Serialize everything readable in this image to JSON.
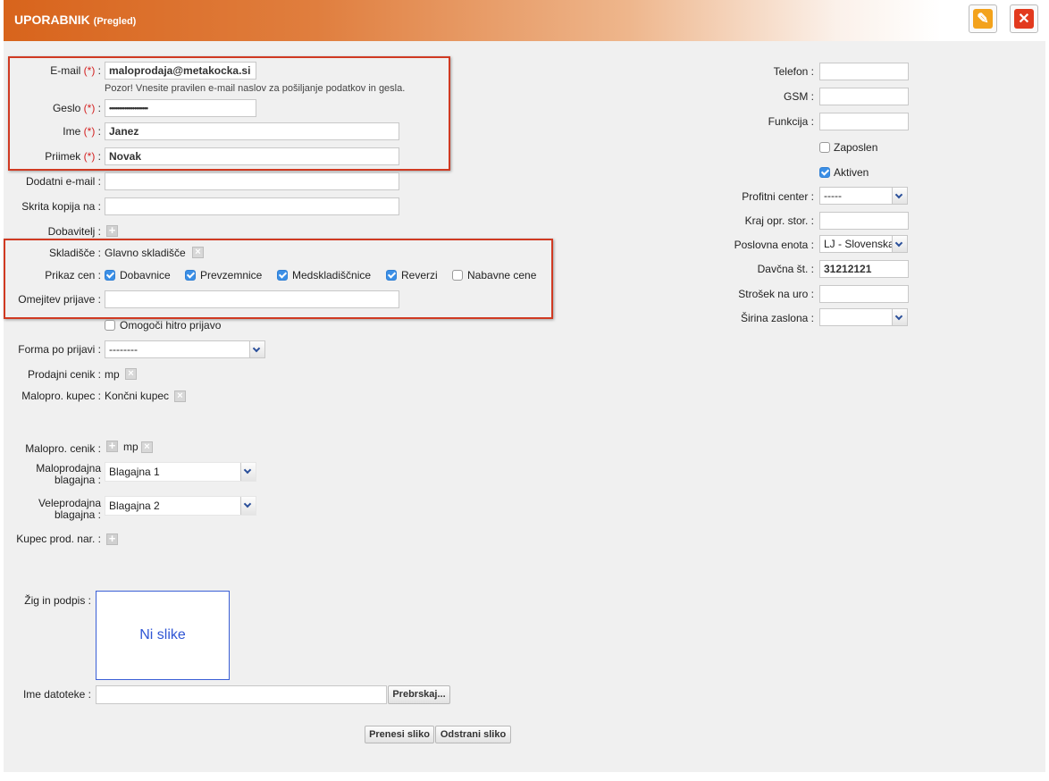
{
  "header": {
    "title": "UPORABNIK",
    "subtitle": "(Pregled)",
    "edit_icon": "pencil-icon",
    "close_icon": "close-icon"
  },
  "left": {
    "email": {
      "label": "E-mail",
      "req": "(*)",
      "value": "maloprodaja@metakocka.si",
      "note": "Pozor! Vnesite pravilen e-mail naslov za pošiljanje podatkov in gesla."
    },
    "geslo": {
      "label": "Geslo",
      "req": "(*)",
      "value": "••••••••••••••••••••"
    },
    "ime": {
      "label": "Ime",
      "req": "(*)",
      "value": "Janez"
    },
    "priimek": {
      "label": "Priimek",
      "req": "(*)",
      "value": "Novak"
    },
    "dodatni_email": {
      "label": "Dodatni e-mail :",
      "value": ""
    },
    "skrita_kopija": {
      "label": "Skrita kopija na :",
      "value": ""
    },
    "dobavitelj": {
      "label": "Dobavitelj :"
    },
    "skladisce": {
      "label": "Skladišče :",
      "value": "Glavno skladišče"
    },
    "prikaz_cen": {
      "label": "Prikaz cen :",
      "options": [
        {
          "label": "Dobavnice",
          "checked": true
        },
        {
          "label": "Prevzemnice",
          "checked": true
        },
        {
          "label": "Medskladiščnice",
          "checked": true
        },
        {
          "label": "Reverzi",
          "checked": true
        },
        {
          "label": "Nabavne cene",
          "checked": false
        }
      ]
    },
    "omejitev_prijave": {
      "label": "Omejitev prijave :",
      "value": ""
    },
    "hitro_prijavo": {
      "label": "Omogoči hitro prijavo",
      "checked": false
    },
    "forma_po_prijavi": {
      "label": "Forma po prijavi :",
      "value": "--------"
    },
    "prodajni_cenik": {
      "label": "Prodajni cenik :",
      "value": "mp"
    },
    "malopro_kupec": {
      "label": "Malopro. kupec :",
      "value": "Končni kupec"
    },
    "malopro_cenik": {
      "label": "Malopro. cenik :",
      "value": "mp"
    },
    "maloprodajna_blagajna": {
      "label1": "Maloprodajna",
      "label2": "blagajna :",
      "value": "Blagajna 1"
    },
    "veleprodajna_blagajna": {
      "label1": "Veleprodajna",
      "label2": "blagajna :",
      "value": "Blagajna 2"
    },
    "kupec_prod_nar": {
      "label": "Kupec prod. nar. :"
    },
    "zig_in_podpis": {
      "label": "Žig in podpis :",
      "placeholder": "Ni slike"
    },
    "ime_datoteke": {
      "label": "Ime datoteke :",
      "value": "",
      "browse": "Prebrskaj..."
    },
    "buttons": {
      "upload": "Prenesi sliko",
      "remove": "Odstrani sliko"
    }
  },
  "right": {
    "telefon": {
      "label": "Telefon :",
      "value": ""
    },
    "gsm": {
      "label": "GSM :",
      "value": ""
    },
    "funkcija": {
      "label": "Funkcija :",
      "value": ""
    },
    "zaposlen": {
      "label": "Zaposlen",
      "checked": false
    },
    "aktiven": {
      "label": "Aktiven",
      "checked": true
    },
    "profitni_center": {
      "label": "Profitni center :",
      "value": "-----"
    },
    "kraj_opr_stor": {
      "label": "Kraj opr. stor. :",
      "value": ""
    },
    "poslovna_enota": {
      "label": "Poslovna enota :",
      "value": "LJ - Slovenska"
    },
    "davcna_st": {
      "label": "Davčna št. :",
      "value": "31212121"
    },
    "strosek_na_uro": {
      "label": "Strošek na uro :",
      "value": ""
    },
    "sirina_zaslona": {
      "label": "Širina zaslona :",
      "value": ""
    }
  }
}
